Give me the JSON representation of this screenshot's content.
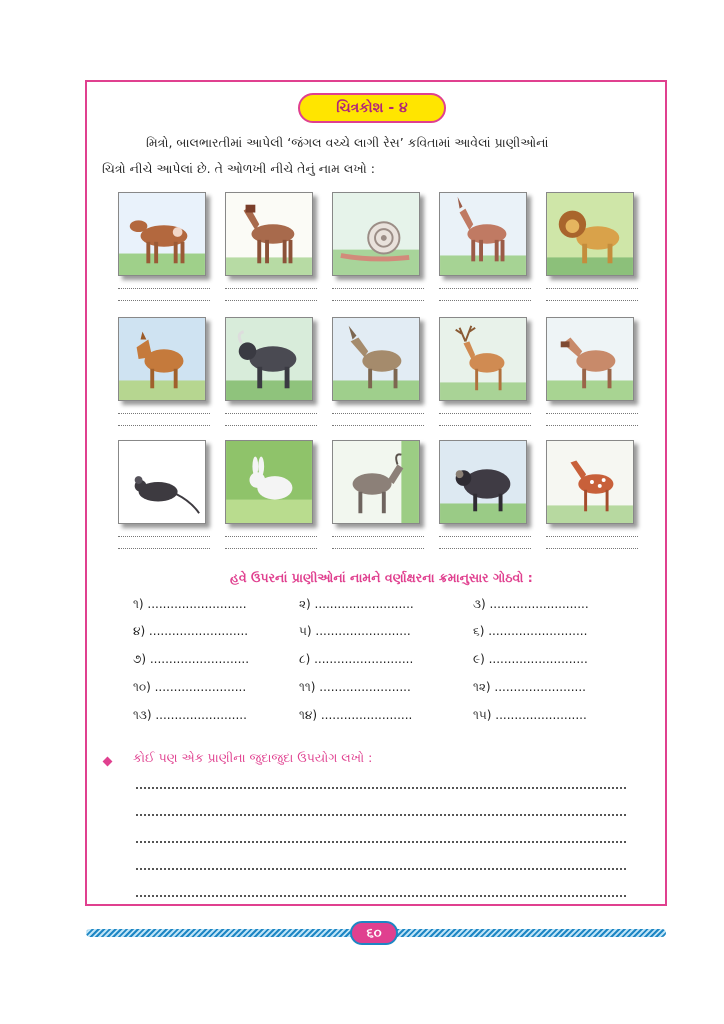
{
  "title": "ચિત્રકોશ - ૪",
  "intro": {
    "line1": "મિત્રો, બાલભારતીમાં આપેલી ‘જંગલ વચ્ચે લાગી રેસ’ કવિતામાં આવેલાં પ્રાણીઓનાં",
    "line2": "ચિત્રો નીચે આપેલાં છે. તે ઓળખી નીચે તેનું નામ લખો :"
  },
  "animals": [
    "cow-icon",
    "horse-icon",
    "snail-icon",
    "donkey-icon",
    "lion-icon",
    "wolf-icon",
    "yak-icon",
    "donkey-icon",
    "deer-icon",
    "horse-icon",
    "mouse-icon",
    "rabbit-icon",
    "goat-icon",
    "sheep-icon",
    "deer-icon"
  ],
  "subheading": "હવે ઉપરનાં પ્રાણીઓનાં નામને વર્ણાક્ષરના ક્રમાનુસાર ગોઠવો :",
  "numbered": [
    "૧) ..........................",
    "૨) ..........................",
    "૩) ..........................",
    "૪) ..........................",
    "૫) .........................",
    "૬) ..........................",
    "૭) ..........................",
    "૮) ..........................",
    "૯) ..........................",
    "૧૦) ........................",
    "૧૧) ........................",
    "૧૨) ........................",
    "૧૩) ........................",
    "૧૪) ........................",
    "૧૫) ........................"
  ],
  "question": "કોઈ પણ એક પ્રાણીના જુદાજુદા ઉપયોગ લખો :",
  "page_number": "૬૦",
  "colors": {
    "accent": "#e0408f",
    "pill": "#ffe500",
    "band": "#1d86c4"
  }
}
